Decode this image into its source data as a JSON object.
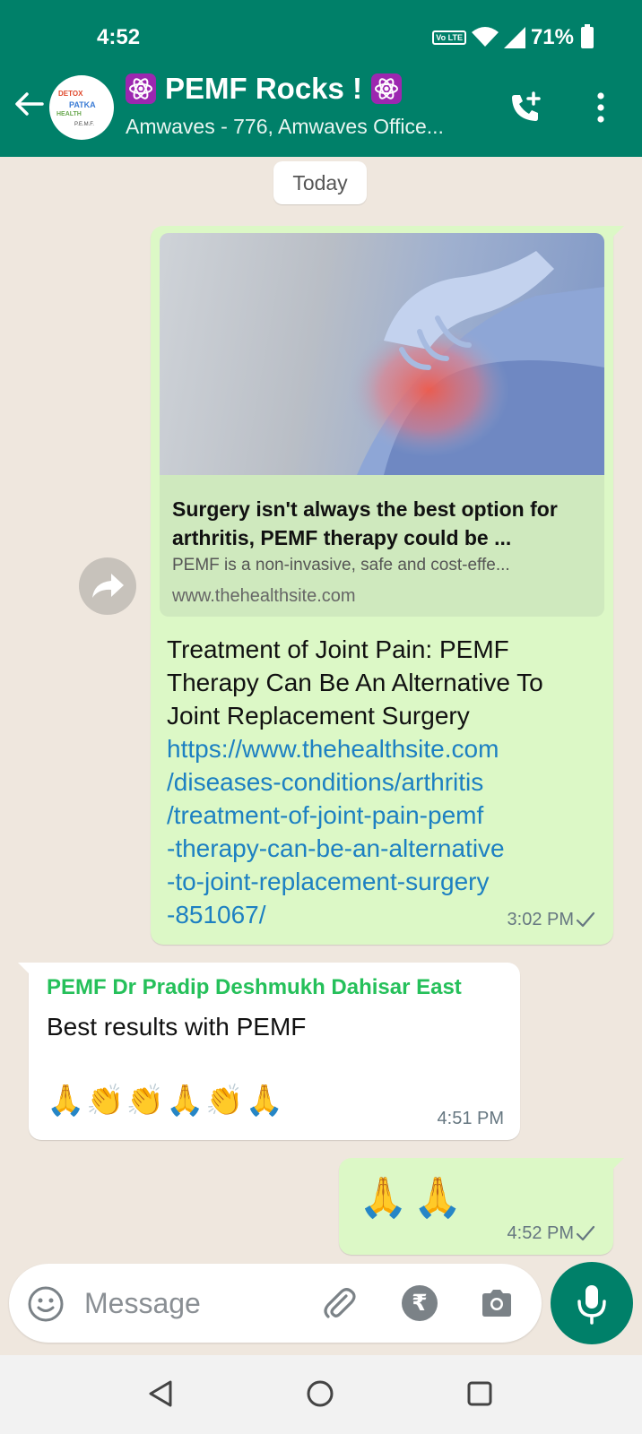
{
  "status_bar": {
    "time": "4:52",
    "volte": "Vo LTE",
    "battery": "71%"
  },
  "chat_header": {
    "title": "PEMF Rocks !",
    "subtitle": "Amwaves - 776, Amwaves Office...",
    "avatar_text": [
      "DETOX",
      "PATKA",
      "HEALTH",
      "P.E.M.F."
    ],
    "emoji_icon": "atom-symbol-icon"
  },
  "date_chip": "Today",
  "messages": [
    {
      "direction": "outgoing",
      "link_preview": {
        "title": "Surgery isn't always the best option for arthritis, PEMF therapy could be ...",
        "description": "PEMF is a non-invasive, safe and cost-effe...",
        "domain": "www.thehealthsite.com"
      },
      "text": "Treatment of Joint Pain: PEMF Therapy Can Be An Alternative To Joint Replacement Surgery",
      "link": "https://www.thehealthsite.com\n/diseases-conditions/arthritis\n/treatment-of-joint-pain-pemf\n-therapy-can-be-an-alternative\n-to-joint-replacement-surgery\n-851067/",
      "time": "3:02 PM"
    },
    {
      "direction": "incoming",
      "sender": "PEMF Dr Pradip Deshmukh Dahisar East",
      "text": "Best results with PEMF",
      "emoji": "🙏👏👏🙏👏🙏",
      "time": "4:51 PM"
    },
    {
      "direction": "outgoing",
      "emoji": "🙏🙏",
      "time": "4:52 PM"
    }
  ],
  "composer": {
    "placeholder": "Message",
    "rupee": "₹"
  },
  "colors": {
    "header": "#008069",
    "outgoing_bubble": "#dcf8c6",
    "incoming_bubble": "#ffffff",
    "link": "#1d80c2",
    "sender_name": "#25c05a",
    "chat_background": "#efe7de"
  }
}
